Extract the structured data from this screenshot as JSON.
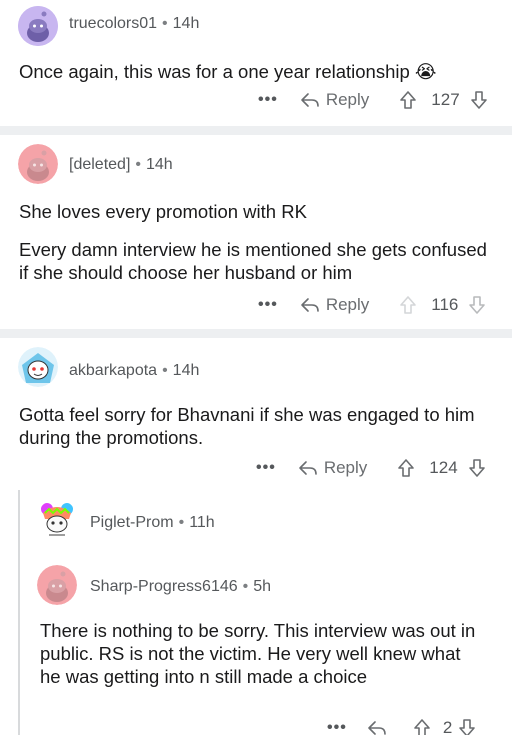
{
  "comments": [
    {
      "username": "truecolors01",
      "time": "14h",
      "body": [
        "Once again, this was for a one year relationship 😭"
      ],
      "reply_label": "Reply",
      "votes": "127",
      "avatar_color": "#c8b6f0"
    },
    {
      "username": "[deleted]",
      "time": "14h",
      "body": [
        "She loves  every promotion with RK",
        "Every damn interview he is mentioned she gets confused if she should choose her husband or him"
      ],
      "reply_label": "Reply",
      "votes": "116",
      "avatar_color": "#f5a3a8"
    },
    {
      "username": "akbarkapota",
      "time": "14h",
      "body": [
        "Gotta feel sorry for Bhavnani if she was engaged to him during the promotions."
      ],
      "reply_label": "Reply",
      "votes": "124",
      "avatar_color": "#9fd8f0"
    },
    {
      "username": "Piglet-Prom",
      "time": "11h",
      "avatar_color": "#ffffff"
    },
    {
      "username": "Sharp-Progress6146",
      "time": "5h",
      "body": [
        "There is nothing to be sorry. This interview was out in public. RS is not the victim. He very well knew what he was getting into n still made a choice"
      ],
      "votes": "2",
      "avatar_color": "#f5a3a8"
    }
  ],
  "more_label": "•••",
  "colors": {
    "upvote_active": "#555",
    "divider": "#edeff1"
  }
}
